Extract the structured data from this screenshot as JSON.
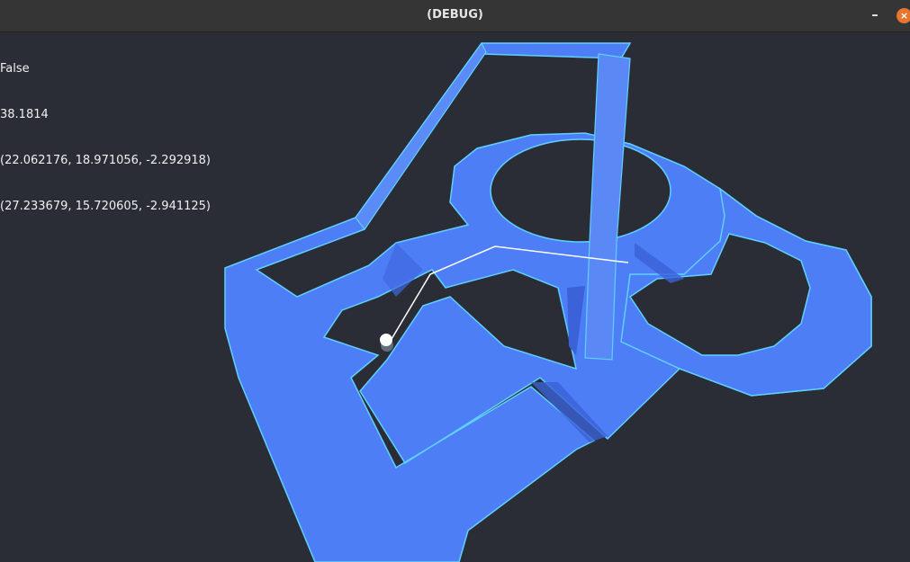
{
  "window": {
    "title": "(DEBUG)",
    "minimize_glyph": "–",
    "close_glyph": "×"
  },
  "debug": {
    "line1": "False",
    "line2": "38.1814",
    "line3": "(22.062176, 18.971056, -2.292918)",
    "line4": "(27.233679, 15.720605, -2.941125)"
  },
  "colors": {
    "background": "#2a2d35",
    "track_fill": "#4d7ef5",
    "track_edge": "#5fd0ff",
    "track_shadow": "#3b62d8",
    "ball": "#ffffff",
    "aim_line": "#ffffff"
  },
  "icons": {
    "minimize": "minimize-icon",
    "close": "close-icon"
  }
}
